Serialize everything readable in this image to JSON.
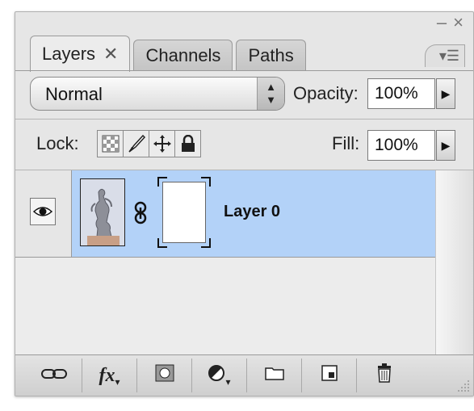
{
  "window": {
    "minimize_icon": "minimize-icon",
    "close_icon": "close-icon"
  },
  "tabs": [
    {
      "label": "Layers",
      "active": true,
      "close_glyph": "✕"
    },
    {
      "label": "Channels",
      "active": false
    },
    {
      "label": "Paths",
      "active": false
    }
  ],
  "panel_menu_icon": "panel-menu-icon",
  "blend_mode": {
    "value": "Normal"
  },
  "opacity": {
    "label": "Opacity:",
    "value": "100%"
  },
  "lock": {
    "label": "Lock:",
    "icons": [
      "lock-transparent-pixels-icon",
      "lock-image-pixels-icon",
      "lock-position-icon",
      "lock-all-icon"
    ]
  },
  "fill": {
    "label": "Fill:",
    "value": "100%"
  },
  "layers": [
    {
      "name": "Layer 0",
      "visible": true,
      "selected": true,
      "has_mask": true
    }
  ],
  "bottom_toolbar": [
    "link-layers-icon",
    "fx-icon",
    "add-mask-icon",
    "adjustment-layer-icon",
    "new-group-icon",
    "new-layer-icon",
    "delete-layer-icon"
  ],
  "fx_label": "fx",
  "colors": {
    "selected_row": "#b3d2f8",
    "panel_bg": "#e6e6e6"
  }
}
